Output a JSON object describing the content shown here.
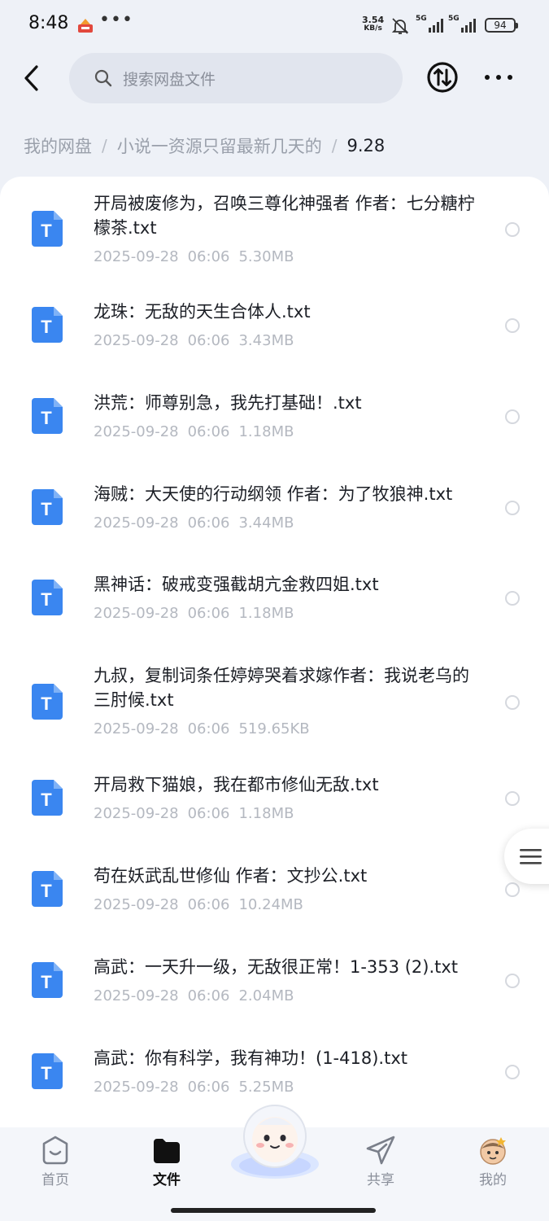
{
  "status_bar": {
    "time": "8:48",
    "net_speed_value": "3.54",
    "net_speed_unit": "KB/s",
    "signal1": "5G",
    "signal2": "5G",
    "battery": "94"
  },
  "header": {
    "search_placeholder": "搜索网盘文件"
  },
  "breadcrumb": {
    "items": [
      "我的网盘",
      "小说一资源只留最新几天的"
    ],
    "current": "9.28"
  },
  "files": [
    {
      "name": "开局被废修为，召唤三尊化神强者 作者：七分糖柠檬茶.txt",
      "date": "2025-09-28",
      "time": "06:06",
      "size": "5.30MB"
    },
    {
      "name": "龙珠：无敌的天生合体人.txt",
      "date": "2025-09-28",
      "time": "06:06",
      "size": "3.43MB"
    },
    {
      "name": "洪荒：师尊别急，我先打基础！.txt",
      "date": "2025-09-28",
      "time": "06:06",
      "size": "1.18MB"
    },
    {
      "name": "海贼：大天使的行动纲领 作者：为了牧狼神.txt",
      "date": "2025-09-28",
      "time": "06:06",
      "size": "3.44MB"
    },
    {
      "name": "黑神话：破戒变强截胡亢金救四姐.txt",
      "date": "2025-09-28",
      "time": "06:06",
      "size": "1.18MB"
    },
    {
      "name": "九叔，复制词条任婷婷哭着求嫁作者：我说老乌的三肘候.txt",
      "date": "2025-09-28",
      "time": "06:06",
      "size": "519.65KB"
    },
    {
      "name": "开局救下猫娘，我在都市修仙无敌.txt",
      "date": "2025-09-28",
      "time": "06:06",
      "size": "1.18MB"
    },
    {
      "name": "苟在妖武乱世修仙 作者：文抄公.txt",
      "date": "2025-09-28",
      "time": "06:06",
      "size": "10.24MB"
    },
    {
      "name": "高武：一天升一级，无敌很正常！1-353 (2).txt",
      "date": "2025-09-28",
      "time": "06:06",
      "size": "2.04MB"
    },
    {
      "name": "高武：你有科学，我有神功！(1-418).txt",
      "date": "2025-09-28",
      "time": "06:06",
      "size": "5.25MB"
    }
  ],
  "file_icon_letter": "T",
  "bottom_nav": {
    "home": "首页",
    "files": "文件",
    "share": "共享",
    "mine": "我的"
  },
  "colors": {
    "file_icon": "#3a86f0",
    "background": "#eef1f7",
    "card": "#ffffff"
  }
}
